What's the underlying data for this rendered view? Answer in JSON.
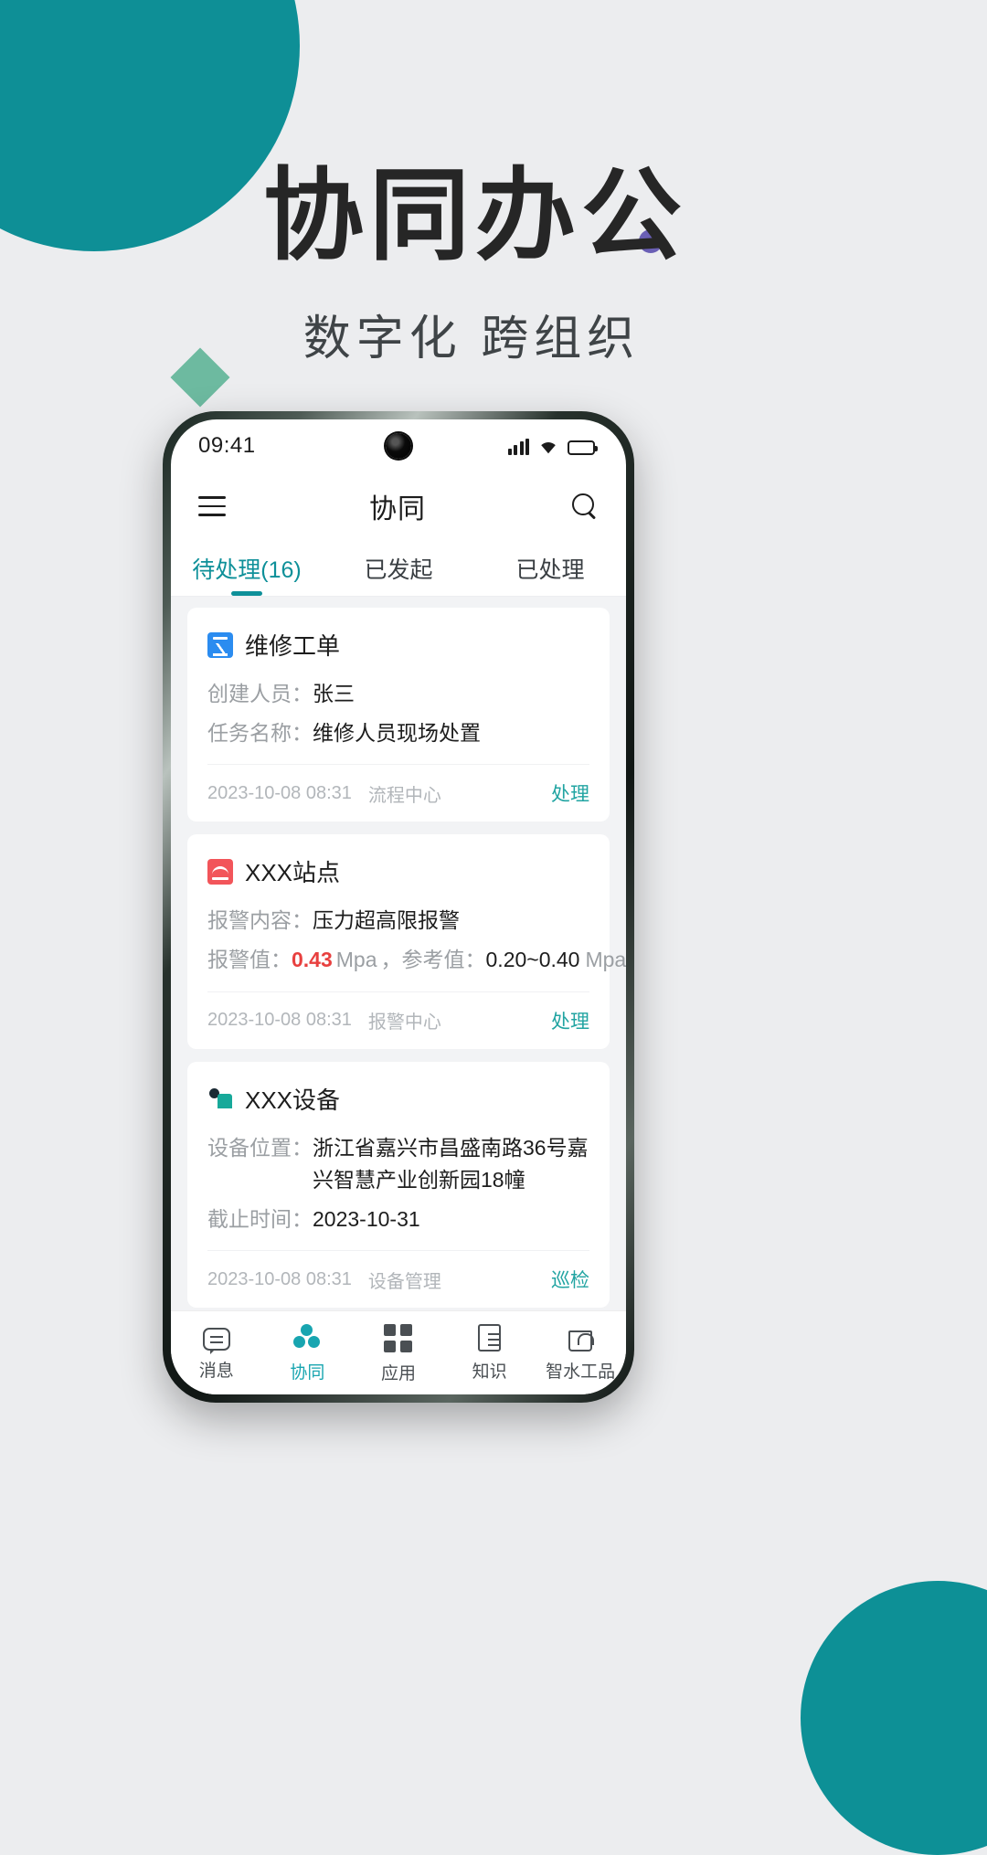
{
  "hero": {
    "title": "协同办公",
    "subtitle": "数字化 跨组织"
  },
  "decor": {
    "teal": "#0e8f96",
    "purple_dot": "#6a5fb5",
    "green_diamond": "#6dbaa0",
    "page_bg": "#ecedef"
  },
  "status_bar": {
    "time": "09:41",
    "signal_icon": "signal-bars-icon",
    "wifi_icon": "wifi-icon",
    "battery_icon": "battery-full-icon"
  },
  "header": {
    "menu_icon": "hamburger-menu-icon",
    "title": "协同",
    "search_icon": "search-icon"
  },
  "tabs": [
    {
      "label": "待处理(16)",
      "active": true
    },
    {
      "label": "已发起",
      "active": false
    },
    {
      "label": "已处理",
      "active": false
    }
  ],
  "accent": "#0e9099",
  "cards": [
    {
      "icon": "work-order-icon",
      "title": "维修工单",
      "fields": [
        {
          "label": "创建人员：",
          "value": "张三",
          "style": "strong"
        },
        {
          "label": "任务名称：",
          "value": "维修人员现场处置",
          "style": "strong"
        }
      ],
      "time": "2023-10-08 08:31",
      "source": "流程中心",
      "action": "处理"
    },
    {
      "icon": "alarm-waveform-icon",
      "title": "XXX站点",
      "fields": [
        {
          "label": "报警内容：",
          "value": "压力超高限报警",
          "style": "strong"
        }
      ],
      "alarm": {
        "label": "报警值：",
        "value": "0.43",
        "unit": "Mpa",
        "separator": "，",
        "ref_label": "参考值：",
        "ref_value": "0.20~0.40",
        "ref_unit": "Mpa",
        "value_color": "#e8403f"
      },
      "time": "2023-10-08 08:31",
      "source": "报警中心",
      "action": "处理"
    },
    {
      "icon": "device-person-icon",
      "title": "XXX设备",
      "fields": [
        {
          "label": "设备位置：",
          "value": "浙江省嘉兴市昌盛南路36号嘉兴智慧产业创新园18幢",
          "style": "strong"
        },
        {
          "label": "截止时间：",
          "value": "2023-10-31",
          "style": "strong"
        }
      ],
      "time": "2023-10-08 08:31",
      "source": "设备管理",
      "action": "巡检"
    }
  ],
  "bottom_nav": [
    {
      "label": "消息",
      "icon": "chat-icon",
      "active": false
    },
    {
      "label": "协同",
      "icon": "collaboration-icon",
      "active": true
    },
    {
      "label": "应用",
      "icon": "grid-apps-icon",
      "active": false
    },
    {
      "label": "知识",
      "icon": "book-icon",
      "active": false
    },
    {
      "label": "智水工品",
      "icon": "shopping-bag-icon",
      "active": false
    }
  ]
}
